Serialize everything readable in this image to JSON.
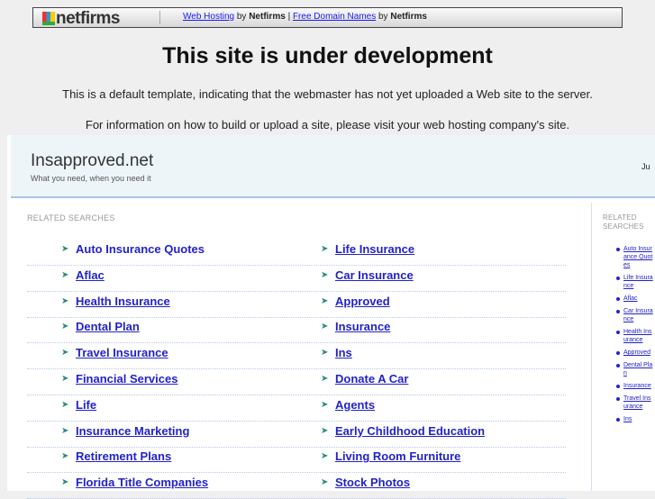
{
  "topbar": {
    "logo": "netfirms",
    "link1": "Web Hosting",
    "by1": "by",
    "brand1": "Netfirms",
    "pipe": "|",
    "link2": "Free Domain Names",
    "by2": "by",
    "brand2": "Netfirms"
  },
  "title": "This site is under development",
  "line1": "This is a default template, indicating that the webmaster has not yet uploaded a Web site to the server.",
  "line2": "For information on how to build or upload a site, please visit your web hosting company's site.",
  "site": {
    "name": "Insapproved.net",
    "tagline": "What you need, when you need it",
    "right_text": "Ju"
  },
  "main": {
    "label": "RELATED SEARCHES",
    "left": [
      "Auto Insurance Quotes",
      "Aflac",
      "Health Insurance",
      "Dental Plan",
      "Travel Insurance",
      "Financial Services",
      "Life",
      "Insurance Marketing",
      "Retirement Plans",
      "Florida Title Companies"
    ],
    "right": [
      "Life Insurance",
      "Car Insurance",
      "Approved",
      "Insurance",
      "Ins",
      "Donate A Car",
      "Agents",
      "Early Childhood Education",
      "Living Room Furniture",
      "Stock Photos"
    ]
  },
  "side": {
    "label": "RELATED SEARCHES",
    "items": [
      "Auto Insurance Quotes",
      "Life Insurance",
      "Aflac",
      "Car Insurance",
      "Health Insurance",
      "Approved",
      "Dental Plan",
      "Insurance",
      "Travel Insurance",
      "Ins"
    ]
  }
}
